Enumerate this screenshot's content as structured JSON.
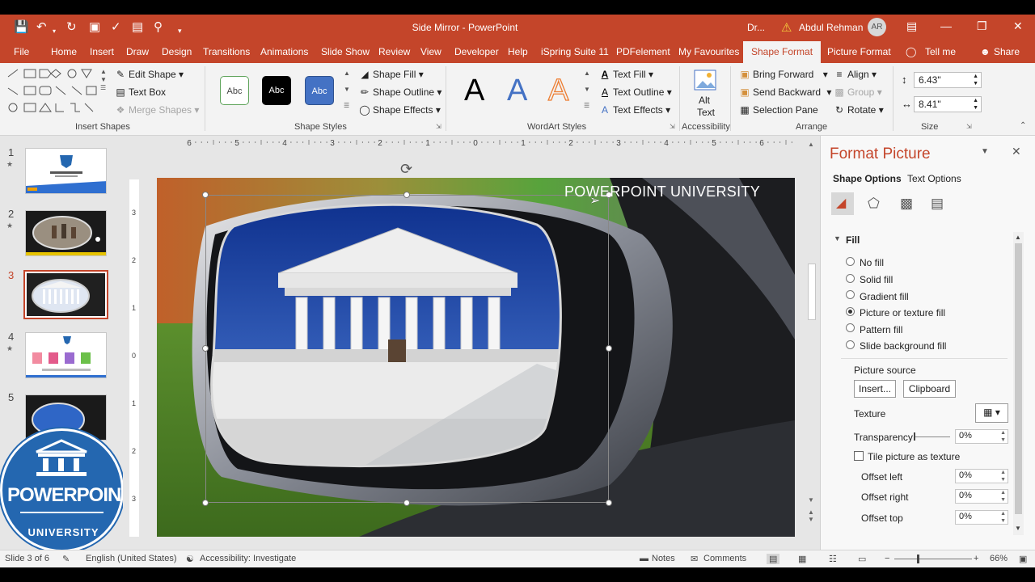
{
  "title_bar": {
    "doc_title": "Side Mirror  -  PowerPoint",
    "dr_label": "Dr...",
    "user_name": "Abdul Rehman",
    "avatar_initials": "AR"
  },
  "tabs": [
    "File",
    "Home",
    "Insert",
    "Draw",
    "Design",
    "Transitions",
    "Animations",
    "Slide Show",
    "Review",
    "View",
    "Developer",
    "Help",
    "iSpring Suite 11",
    "PDFelement",
    "My Favourites",
    "Shape Format",
    "Picture Format",
    "Tell me",
    "Share"
  ],
  "active_tab": "Shape Format",
  "ribbon": {
    "insert_shapes": {
      "label": "Insert Shapes",
      "edit_shape": "Edit Shape",
      "text_box": "Text Box",
      "merge_shapes": "Merge Shapes"
    },
    "shape_styles": {
      "label": "Shape Styles",
      "swatch_text": "Abc",
      "shape_fill": "Shape Fill",
      "shape_outline": "Shape Outline",
      "shape_effects": "Shape Effects"
    },
    "wordart": {
      "label": "WordArt Styles",
      "letter": "A",
      "text_fill": "Text Fill",
      "text_outline": "Text Outline",
      "text_effects": "Text Effects"
    },
    "accessibility": {
      "label": "Accessibility",
      "alt_text": "Alt Text"
    },
    "arrange": {
      "label": "Arrange",
      "bring_forward": "Bring Forward",
      "send_backward": "Send Backward",
      "selection_pane": "Selection Pane",
      "align": "Align",
      "group": "Group",
      "rotate": "Rotate"
    },
    "size": {
      "label": "Size",
      "height": "6.43\"",
      "width": "8.41\""
    }
  },
  "thumbnails": {
    "numbers": [
      "1",
      "2",
      "3",
      "4",
      "5"
    ],
    "selected": "3"
  },
  "logo": {
    "word1": "POWERPOINT",
    "word2": "UNIVERSITY"
  },
  "ruler": {
    "h_labels": [
      "6",
      "5",
      "4",
      "3",
      "2",
      "1",
      "0",
      "1",
      "2",
      "3",
      "4",
      "5",
      "6"
    ],
    "v_labels": [
      "3",
      "2",
      "1",
      "0",
      "1",
      "2",
      "3"
    ]
  },
  "slide": {
    "title": "POWERPOINT UNIVERSITY"
  },
  "format_pane": {
    "title": "Format Picture",
    "tab_shape": "Shape Options",
    "tab_text": "Text Options",
    "section": "Fill",
    "fill_options": [
      "No fill",
      "Solid fill",
      "Gradient fill",
      "Picture or texture fill",
      "Pattern fill",
      "Slide background fill"
    ],
    "selected_fill": "Picture or texture fill",
    "picture_source": "Picture source",
    "insert_btn": "Insert...",
    "clipboard_btn": "Clipboard",
    "texture": "Texture",
    "transparency": "Transparency",
    "transparency_value": "0%",
    "tile_label": "Tile picture as texture",
    "offsets": [
      {
        "label": "Offset left",
        "value": "0%"
      },
      {
        "label": "Offset right",
        "value": "0%"
      },
      {
        "label": "Offset top",
        "value": "0%"
      }
    ]
  },
  "status": {
    "slide_info": "Slide 3 of 6",
    "language": "English (United States)",
    "accessibility": "Accessibility: Investigate",
    "notes": "Notes",
    "comments": "Comments",
    "zoom": "66%"
  },
  "colors": {
    "accent": "#c4452a",
    "logo_blue": "#2467b0"
  }
}
